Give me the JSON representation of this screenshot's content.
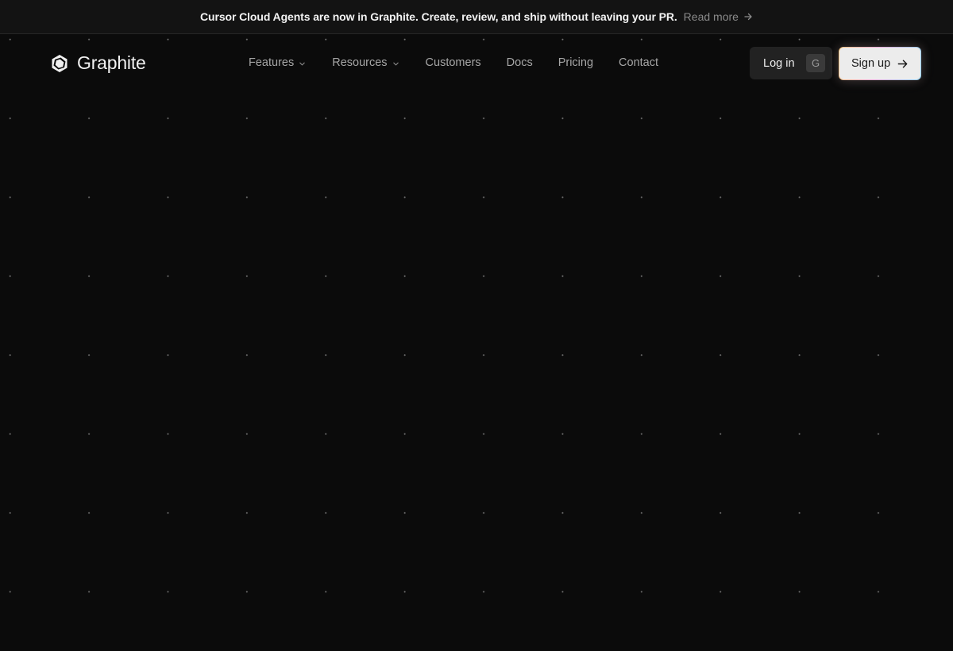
{
  "announcement": {
    "text": "Cursor Cloud Agents are now in Graphite. Create, review, and ship without leaving your PR.",
    "link_label": "Read more",
    "link_icon": "arrow-right-icon"
  },
  "brand": {
    "name": "Graphite",
    "icon": "graphite-logo-icon"
  },
  "nav": {
    "items": [
      {
        "label": "Features",
        "has_dropdown": true
      },
      {
        "label": "Resources",
        "has_dropdown": true
      },
      {
        "label": "Customers",
        "has_dropdown": false
      },
      {
        "label": "Docs",
        "has_dropdown": false
      },
      {
        "label": "Pricing",
        "has_dropdown": false
      },
      {
        "label": "Contact",
        "has_dropdown": false
      }
    ]
  },
  "actions": {
    "login_label": "Log in",
    "login_shortcut": "G",
    "signup_label": "Sign up",
    "signup_icon": "arrow-right-icon"
  },
  "colors": {
    "background": "#0b0b0b",
    "banner_background": "#131313",
    "signup_background": "#ececec",
    "login_background": "#222222"
  }
}
